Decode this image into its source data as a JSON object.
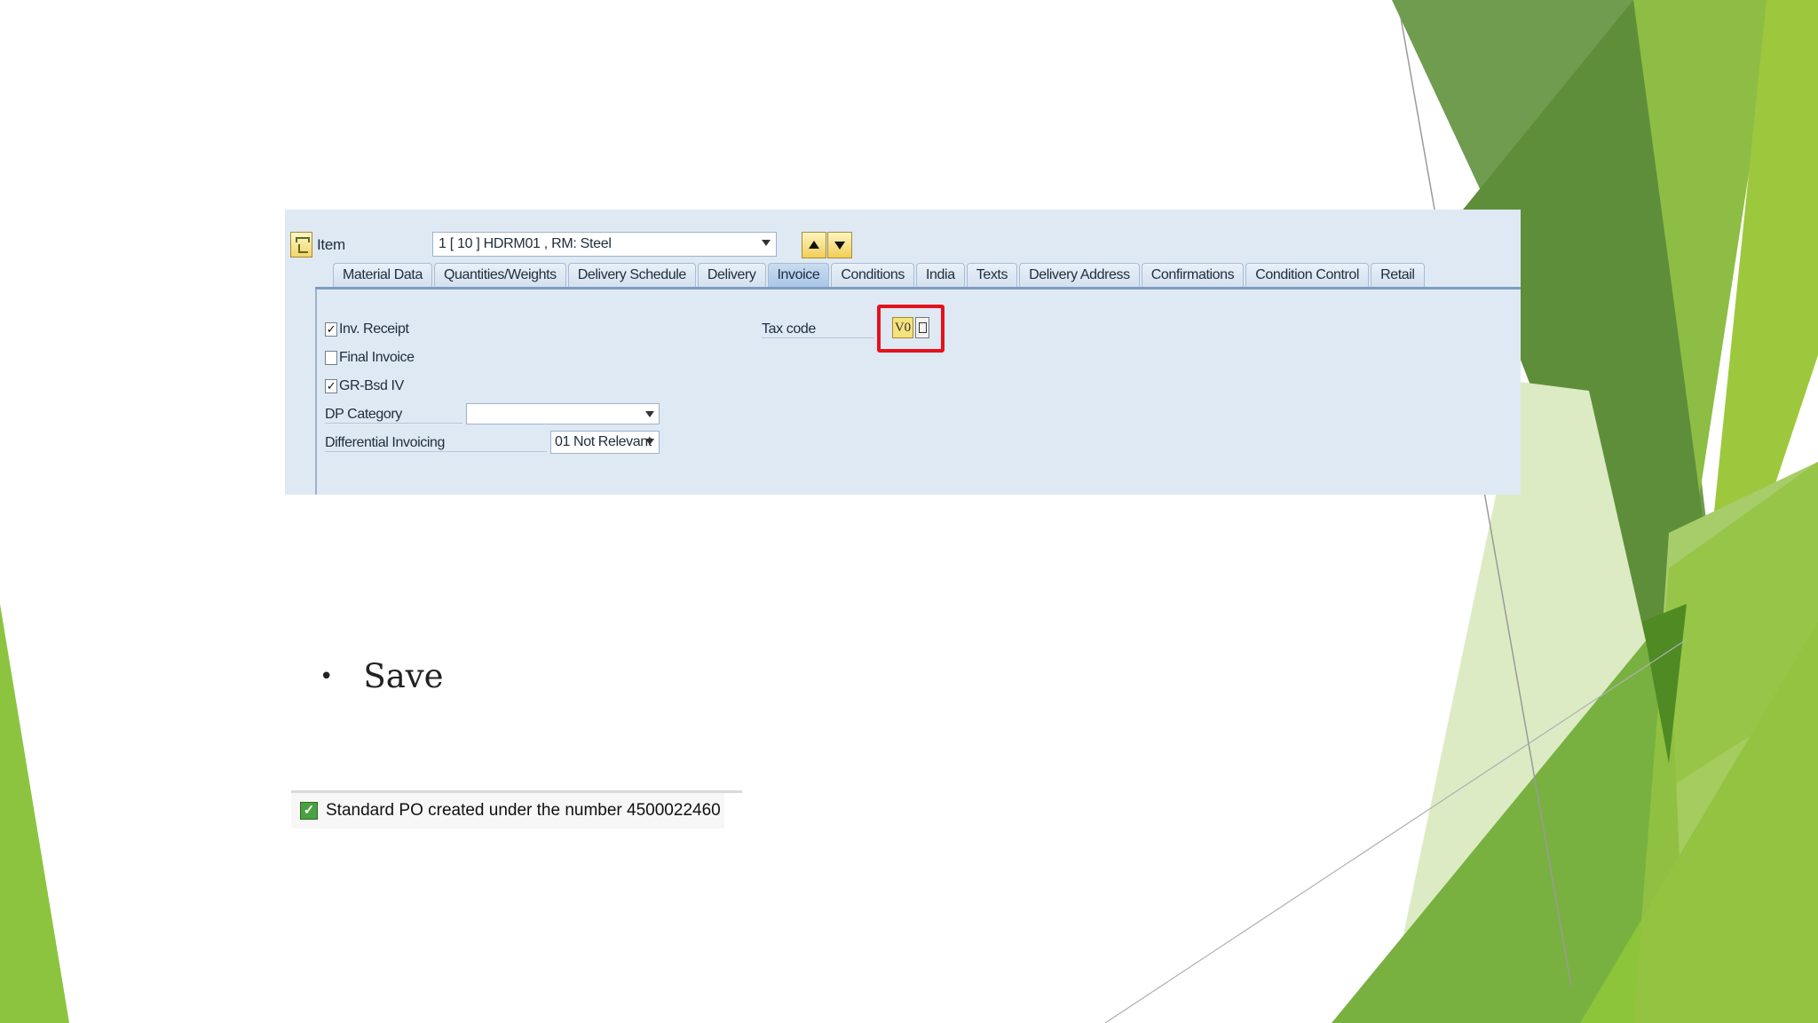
{
  "sap": {
    "item_label": "Item",
    "item_value": "1 [ 10 ] HDRM01 , RM: Steel",
    "tabs": [
      {
        "label": "Material Data"
      },
      {
        "label": "Quantities/Weights"
      },
      {
        "label": "Delivery Schedule"
      },
      {
        "label": "Delivery"
      },
      {
        "label": "Invoice",
        "active": true
      },
      {
        "label": "Conditions"
      },
      {
        "label": "India"
      },
      {
        "label": "Texts"
      },
      {
        "label": "Delivery Address"
      },
      {
        "label": "Confirmations"
      },
      {
        "label": "Condition Control"
      },
      {
        "label": "Retail"
      }
    ],
    "inv_receipt": {
      "label": "Inv. Receipt",
      "checked": true
    },
    "final_invoice": {
      "label": "Final Invoice",
      "checked": false
    },
    "gr_bsd_iv": {
      "label": "GR-Bsd IV",
      "checked": true
    },
    "dp_category_label": "DP Category",
    "dp_category_value": "",
    "diff_invoicing_label": "Differential Invoicing",
    "diff_invoicing_value": "01 Not Relevant",
    "tax_code_label": "Tax code",
    "tax_code_value": "V0",
    "highlight_color": "#e3121c"
  },
  "bullet": {
    "text": "Save"
  },
  "status": {
    "message": "Standard PO created under the number 4500022460",
    "type": "success"
  },
  "colors": {
    "accent_green": "#8dc03f",
    "dark_green": "#4f8a23"
  }
}
